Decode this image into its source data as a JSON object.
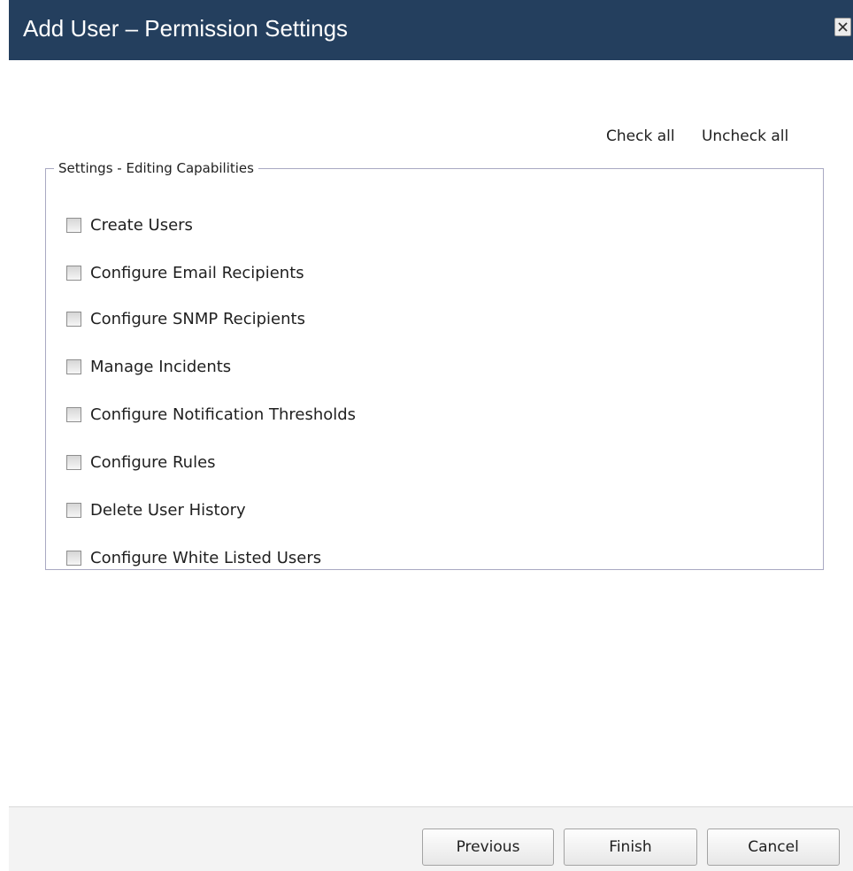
{
  "dialog": {
    "title": "Add User – Permission Settings",
    "close_icon": "close-icon"
  },
  "bulk": {
    "check_all": "Check all",
    "uncheck_all": "Uncheck all"
  },
  "fieldset": {
    "legend": "Settings - Editing Capabilities",
    "permissions": [
      {
        "label": "Create Users",
        "checked": false
      },
      {
        "label": "Configure Email Recipients",
        "checked": false
      },
      {
        "label": "Configure SNMP Recipients",
        "checked": false
      },
      {
        "label": "Manage Incidents",
        "checked": false
      },
      {
        "label": "Configure Notification Thresholds",
        "checked": false
      },
      {
        "label": "Configure Rules",
        "checked": false
      },
      {
        "label": "Delete User History",
        "checked": false
      },
      {
        "label": "Configure White Listed Users",
        "checked": false
      }
    ]
  },
  "footer": {
    "previous_label": "Previous",
    "finish_label": "Finish",
    "cancel_label": "Cancel"
  },
  "colors": {
    "titlebar": "#243f5e",
    "title_text": "#ffffff",
    "fieldset_border": "#a9a9c2",
    "footer_bg": "#f3f3f3"
  }
}
